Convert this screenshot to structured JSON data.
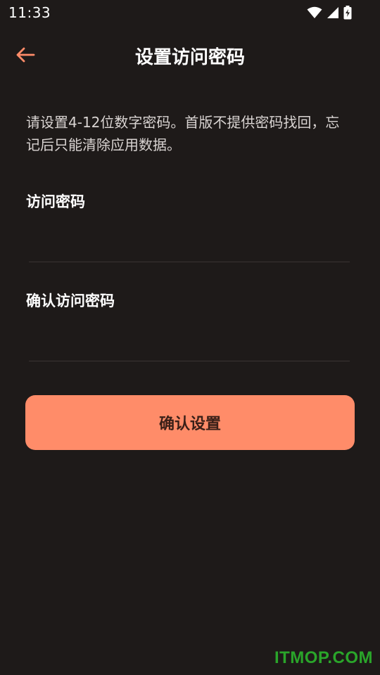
{
  "status_bar": {
    "time": "11:33",
    "icons": [
      "wifi-icon",
      "cellular-signal-icon",
      "battery-charging-icon"
    ]
  },
  "app_bar": {
    "back_icon": "arrow-left-icon",
    "title": "设置访问密码"
  },
  "description": "请设置4-12位数字密码。首版不提供密码找回，忘记后只能清除应用数据。",
  "form": {
    "password_label": "访问密码",
    "password_value": "",
    "confirm_label": "确认访问密码",
    "confirm_value": "",
    "submit_label": "确认设置"
  },
  "watermark": "ITMOP.COM",
  "colors": {
    "background": "#1e1a19",
    "accent": "#ff8c69",
    "button_text": "#3a2018",
    "watermark": "#2aa52a"
  }
}
